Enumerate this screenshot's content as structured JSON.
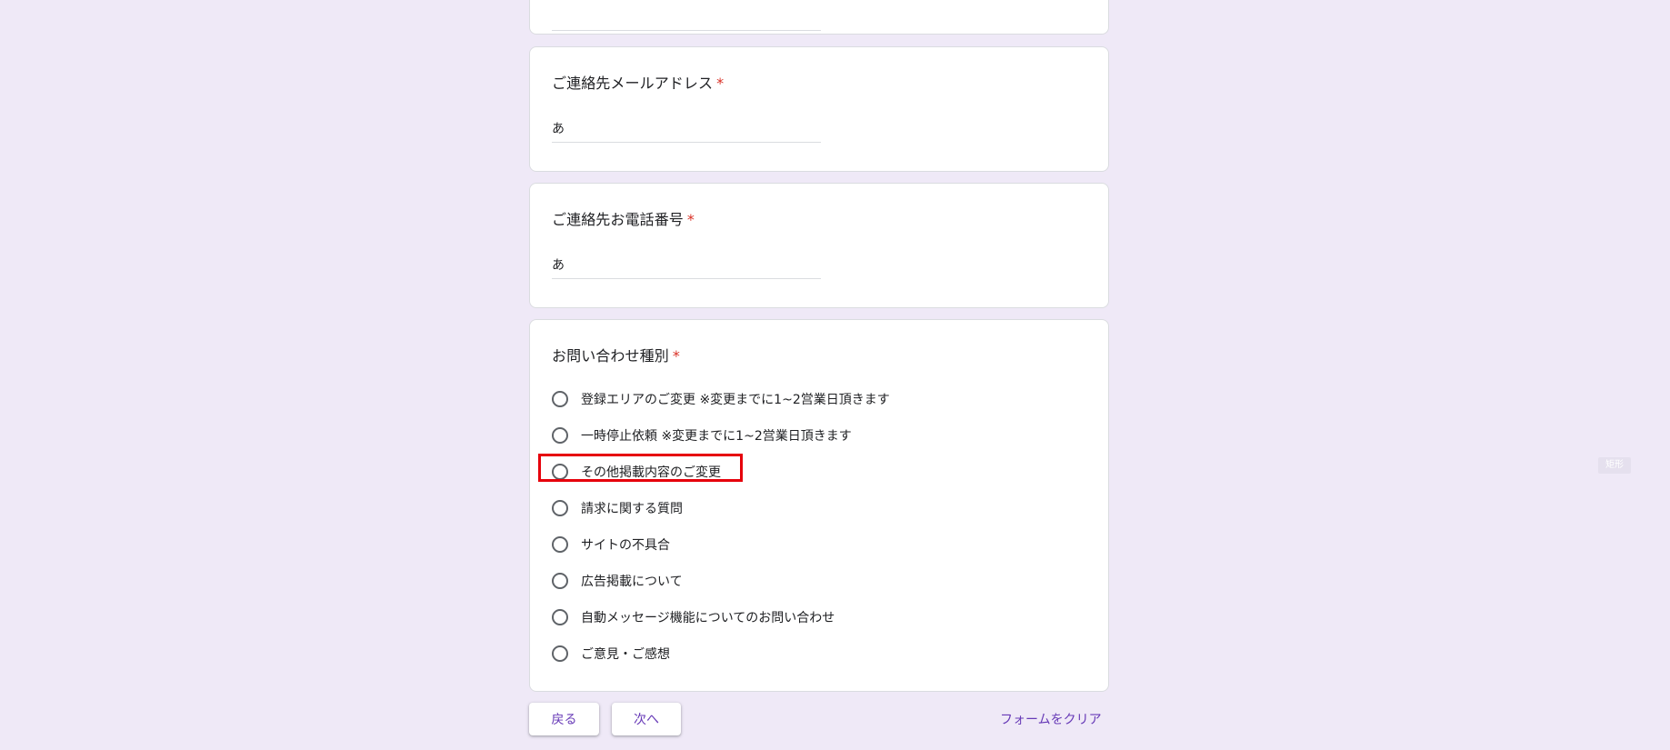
{
  "form": {
    "questions": [
      {
        "title": "ご連絡先メールアドレス",
        "required_mark": "*",
        "answer": "あ"
      },
      {
        "title": "ご連絡先お電話番号",
        "required_mark": "*",
        "answer": "あ"
      },
      {
        "title": "お問い合わせ種別",
        "required_mark": "*",
        "options": [
          "登録エリアのご変更 ※変更までに1~2営業日頂きます",
          "一時停止依頼 ※変更までに1~2営業日頂きます",
          "その他掲載内容のご変更",
          "請求に関する質問",
          "サイトの不具合",
          "広告掲載について",
          "自動メッセージ機能についてのお問い合わせ",
          "ご意見・ご感想"
        ],
        "highlighted_option": "その他掲載内容のご変更"
      }
    ],
    "buttons": {
      "back": "戻る",
      "next": "次へ",
      "clear": "フォームをクリア"
    }
  },
  "side_tag": "矩形",
  "colors": {
    "background": "#efe9f7",
    "accent": "#673ab7",
    "required": "#d93025",
    "highlight_box": "#e6000b"
  }
}
